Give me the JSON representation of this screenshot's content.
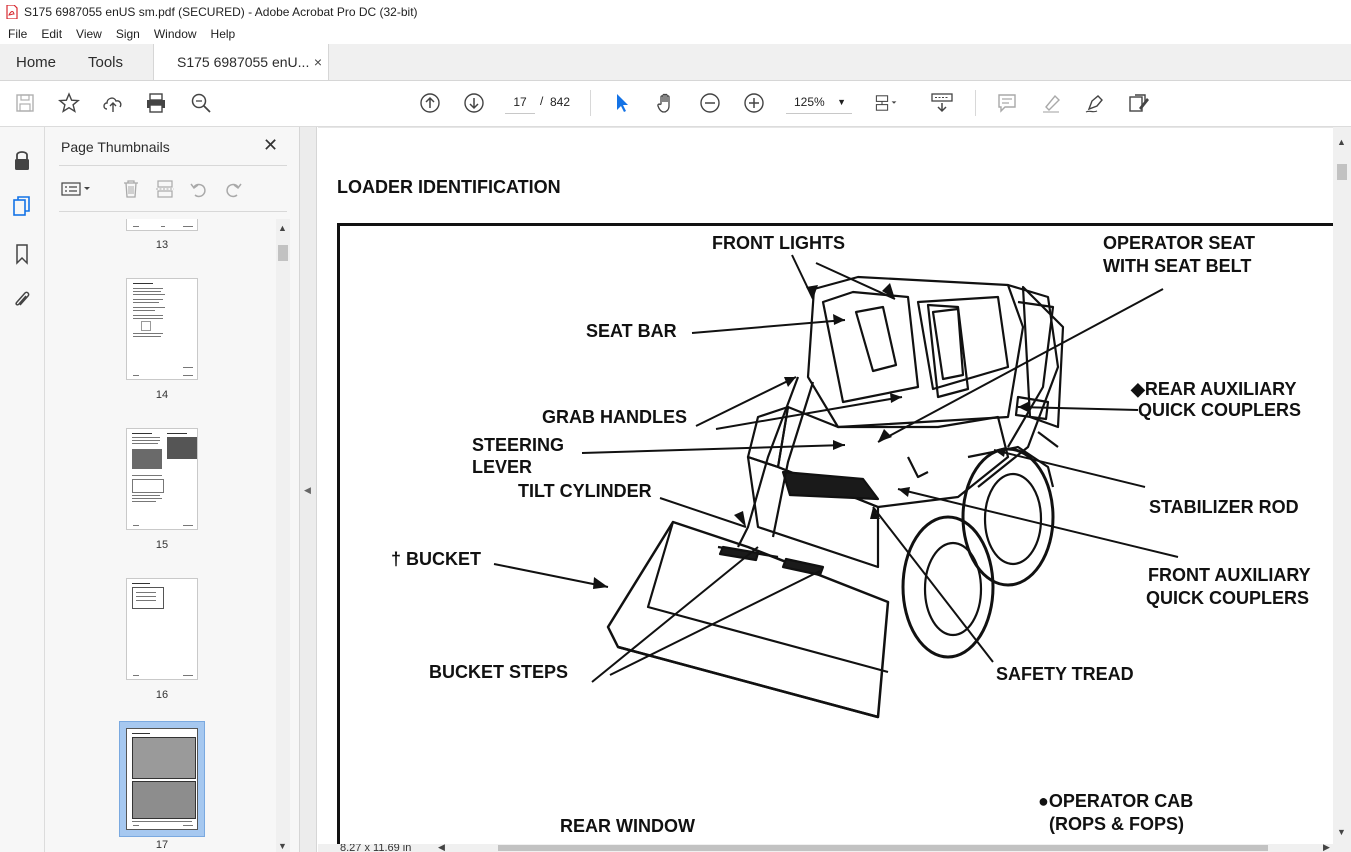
{
  "window": {
    "title": "S175 6987055 enUS sm.pdf (SECURED) - Adobe Acrobat Pro DC (32-bit)"
  },
  "menu": [
    "File",
    "Edit",
    "View",
    "Sign",
    "Window",
    "Help"
  ],
  "tabs": {
    "home": "Home",
    "tools": "Tools",
    "document": "S175 6987055 enU...",
    "close_glyph": "×"
  },
  "toolbar": {
    "current_page": "17",
    "page_separator": "/",
    "total_pages": "842",
    "zoom": "125%"
  },
  "sidebar": {
    "title": "Page Thumbnails",
    "close_glyph": "✕",
    "thumbnails": [
      {
        "label": "13"
      },
      {
        "label": "14"
      },
      {
        "label": "15"
      },
      {
        "label": "16"
      },
      {
        "label": "17",
        "selected": true
      }
    ]
  },
  "document": {
    "heading": "LOADER IDENTIFICATION",
    "labels": {
      "front_lights": "FRONT LIGHTS",
      "operator_seat_1": "OPERATOR SEAT",
      "operator_seat_2": "WITH SEAT BELT",
      "seat_bar": "SEAT BAR",
      "rear_aux_1": "◆REAR AUXILIARY",
      "rear_aux_2": "QUICK COUPLERS",
      "grab_handles": "GRAB HANDLES",
      "steering_1": "STEERING",
      "steering_2": "LEVER",
      "tilt_cylinder": "TILT CYLINDER",
      "stabilizer_rod": "STABILIZER ROD",
      "bucket": "† BUCKET",
      "front_aux_1": "FRONT AUXILIARY",
      "front_aux_2": "QUICK COUPLERS",
      "bucket_steps": "BUCKET STEPS",
      "safety_tread": "SAFETY TREAD",
      "operator_cab_1": "●OPERATOR CAB",
      "operator_cab_2": "(ROPS & FOPS)",
      "rear_window": "REAR WINDOW"
    },
    "page_size": "8.27 x 11.69 in"
  },
  "colors": {
    "accent": "#1473e6",
    "pdf_icon": "#d7282f",
    "selected_thumb": "#a6c8f0"
  }
}
